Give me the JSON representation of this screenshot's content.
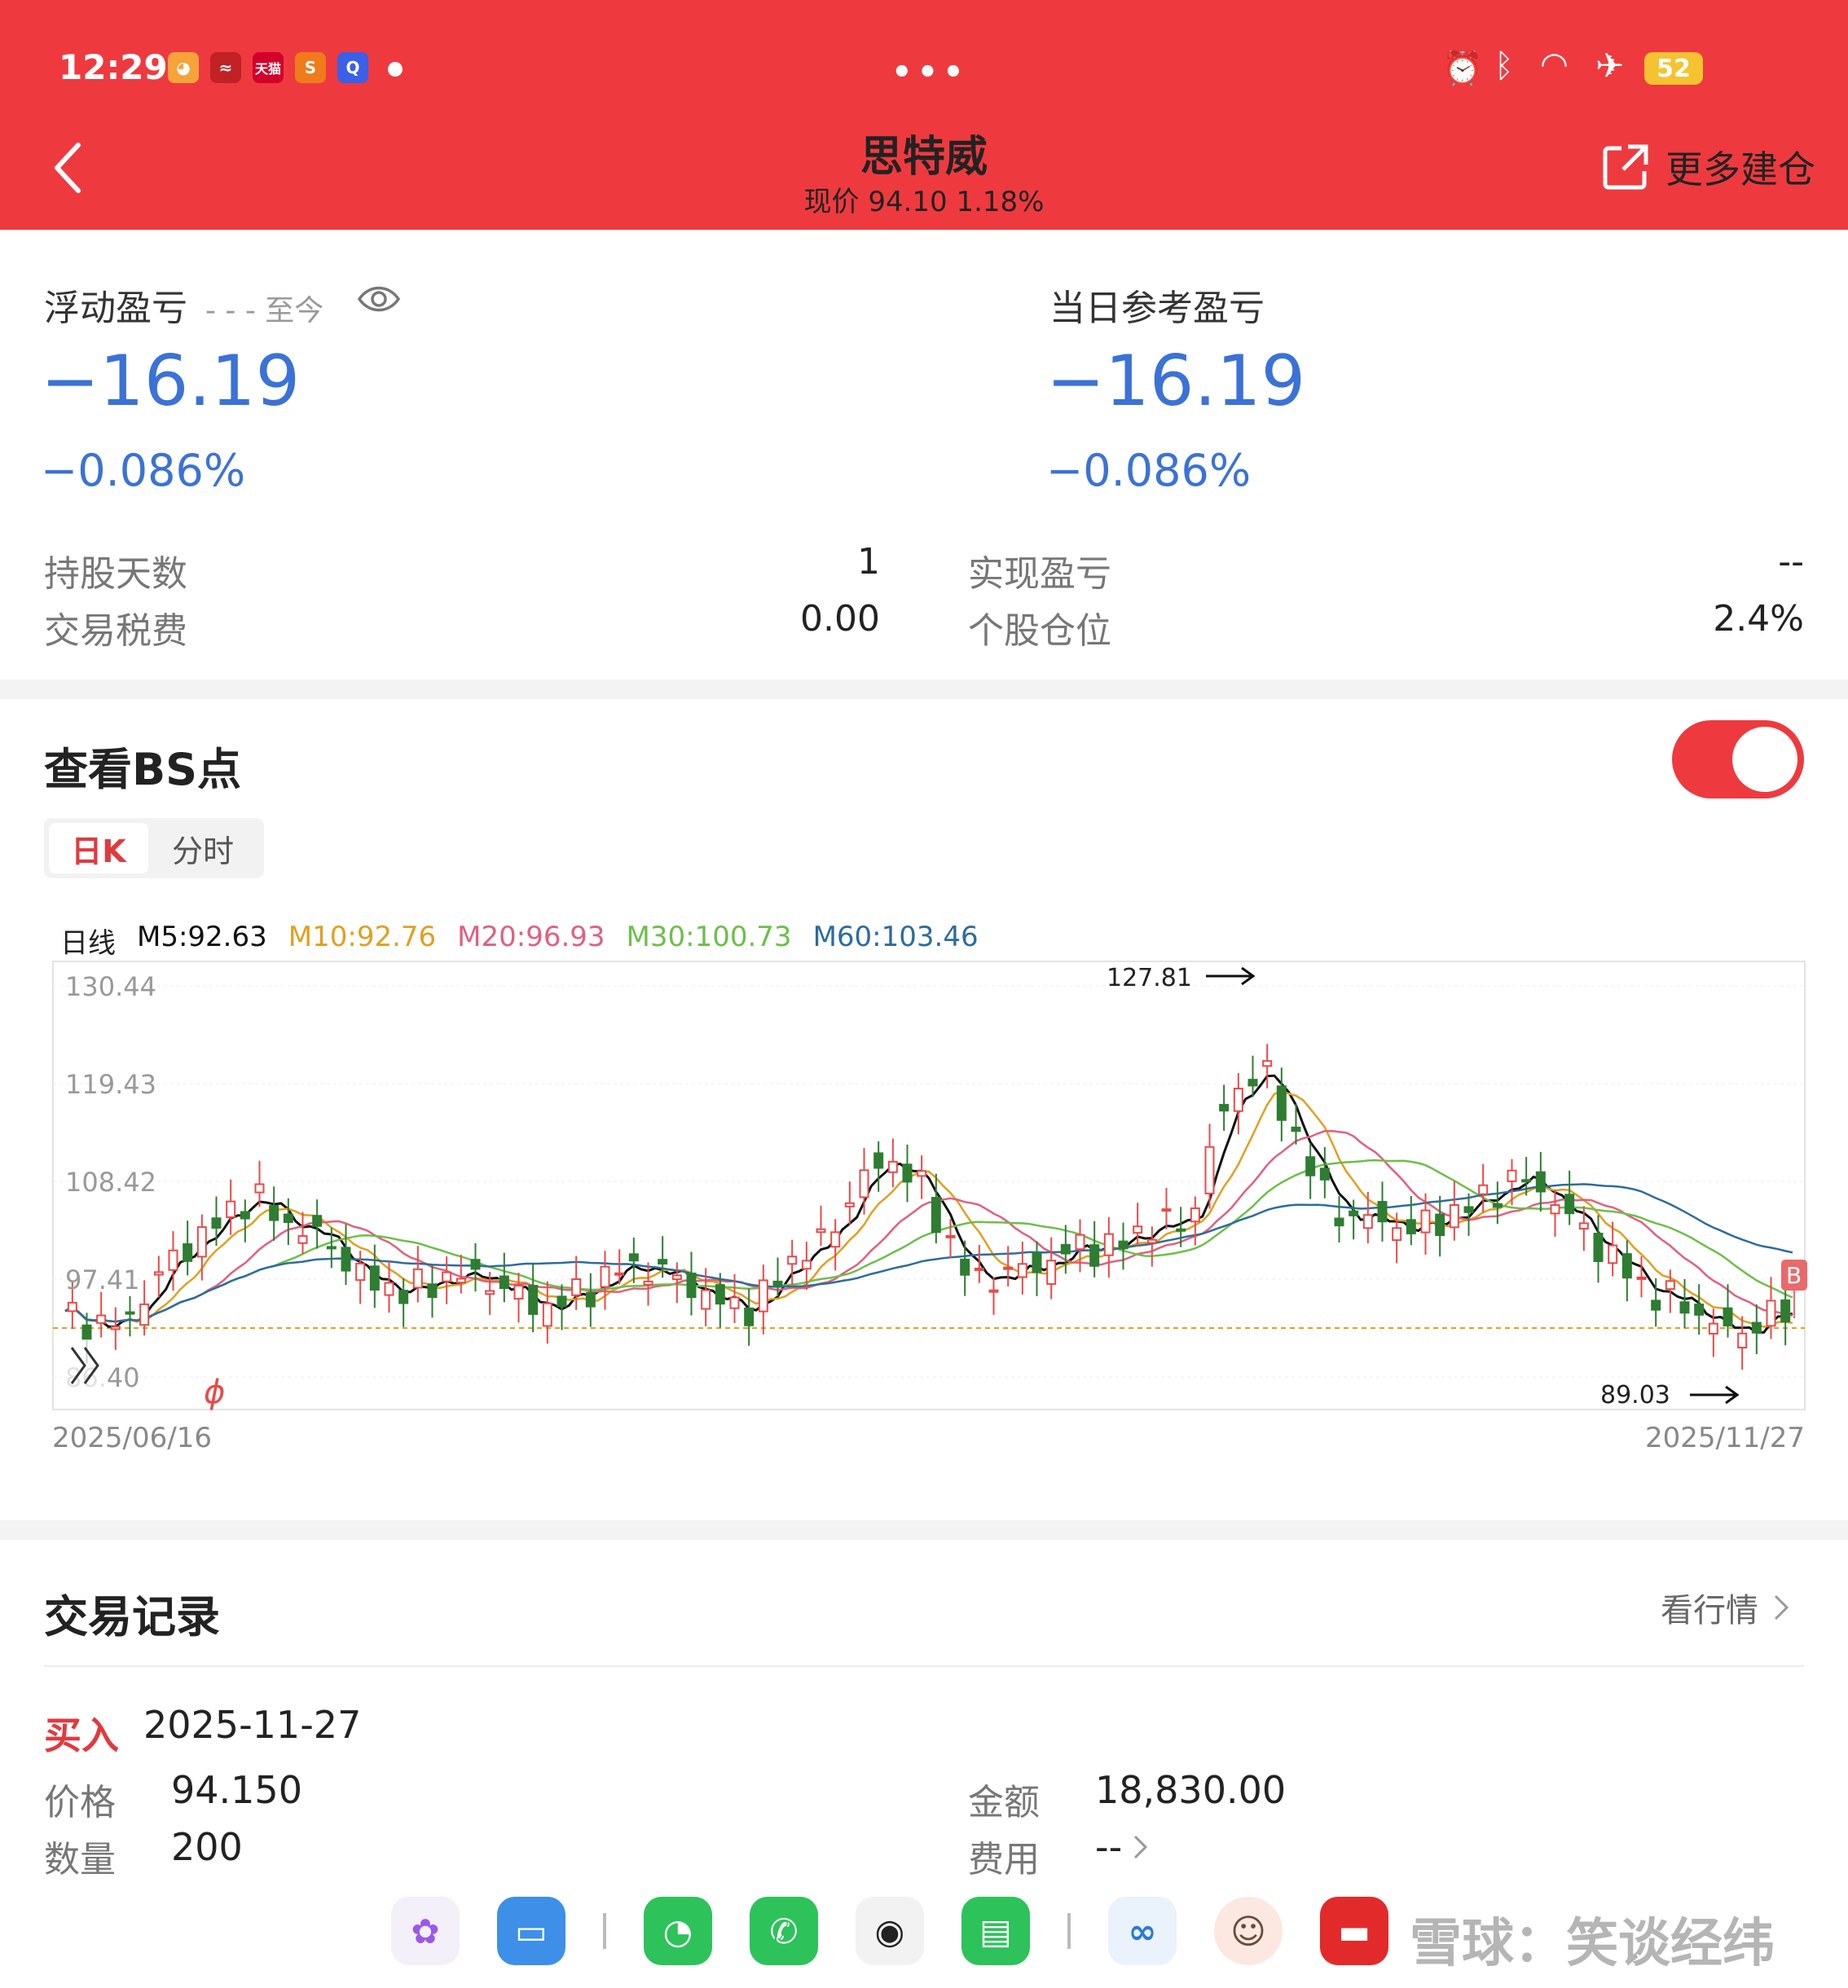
{
  "status_bar": {
    "time": "12:29",
    "apps": [
      "xiaohongshu",
      "app",
      "天猫",
      "S",
      "Q"
    ],
    "battery": "52"
  },
  "header": {
    "title": "思特威",
    "subtitle": "现价 94.10 1.18%",
    "more_build": "更多建仓",
    "back_icon": "chevron-left-icon",
    "share_icon": "external-link-icon"
  },
  "floating_pl": {
    "label": "浮动盈亏",
    "period": "- - - 至今",
    "value": "−16.19",
    "percent": "−0.086%"
  },
  "daily_pl": {
    "label": "当日参考盈亏",
    "value": "−16.19",
    "percent": "−0.086%"
  },
  "stats": {
    "hold_days_label": "持股天数",
    "hold_days_value": "1",
    "fees_label": "交易税费",
    "fees_value": "0.00",
    "realized_label": "实现盈亏",
    "realized_value": "--",
    "position_label": "个股仓位",
    "position_value": "2.4%"
  },
  "bs": {
    "title": "查看BS点",
    "toggle_on": true,
    "tabs": [
      "日K",
      "分时"
    ],
    "active_tab": "日K"
  },
  "chart_legend": {
    "label": "日线",
    "m5": "M5:92.63",
    "m10": "M10:92.76",
    "m20": "M20:96.93",
    "m30": "M30:100.73",
    "m60": "M60:103.46"
  },
  "chart_data": {
    "type": "candlestick",
    "y_ticks": [
      "130.44",
      "119.43",
      "108.42",
      "97.41",
      "86.40"
    ],
    "ylim": [
      86.4,
      130.44
    ],
    "x_start": "2025/06/16",
    "x_end": "2025/11/27",
    "high_annotation": "127.81",
    "low_annotation": "89.03",
    "buy_marker": "B",
    "colors": {
      "up": "#e84a4a",
      "down": "#2e7d32",
      "m5": "#111111",
      "m10": "#e0a020",
      "m20": "#e06080",
      "m30": "#6cbf4a",
      "m60": "#2d6c9c"
    }
  },
  "trade": {
    "title": "交易记录",
    "link": "看行情",
    "type": "买入",
    "date": "2025-11-27",
    "price_label": "价格",
    "price": "94.150",
    "qty_label": "数量",
    "qty": "200",
    "amount_label": "金额",
    "amount": "18,830.00",
    "fee_label": "费用",
    "fee": "--"
  },
  "watermark": "雪球：笑谈经纬"
}
